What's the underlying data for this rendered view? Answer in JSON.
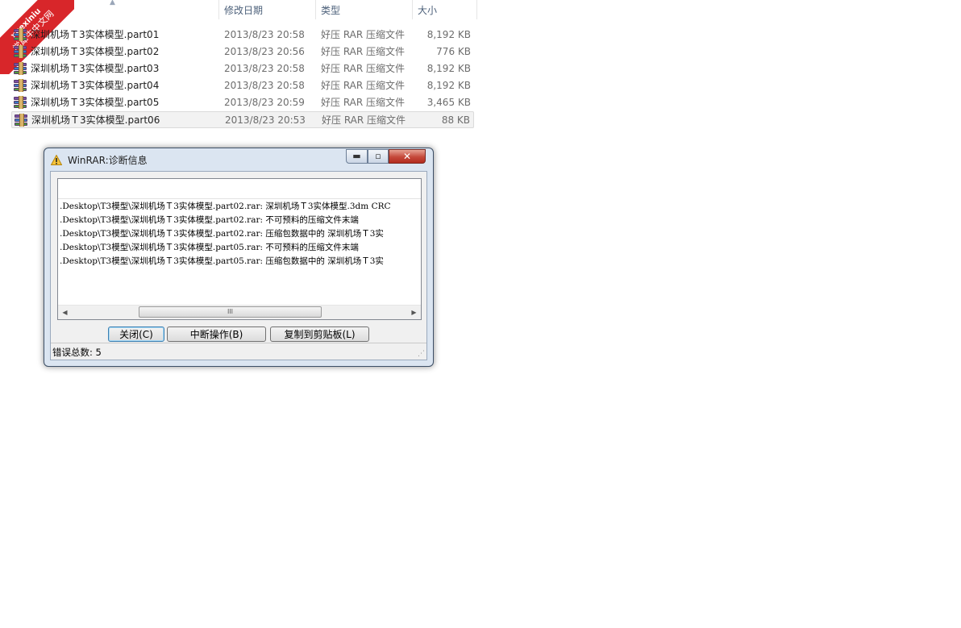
{
  "watermark": {
    "line1": "xuexiniu",
    "line2": "学犀牛中文网"
  },
  "columns": {
    "date": "修改日期",
    "type": "类型",
    "size": "大小"
  },
  "files": [
    {
      "name": "深圳机场Ｔ3实体模型.part01",
      "date": "2013/8/23 20:58",
      "type": "好压 RAR 压缩文件",
      "size": "8,192 KB"
    },
    {
      "name": "深圳机场Ｔ3实体模型.part02",
      "date": "2013/8/23 20:56",
      "type": "好压 RAR 压缩文件",
      "size": "776 KB"
    },
    {
      "name": "深圳机场Ｔ3实体模型.part03",
      "date": "2013/8/23 20:58",
      "type": "好压 RAR 压缩文件",
      "size": "8,192 KB"
    },
    {
      "name": "深圳机场Ｔ3实体模型.part04",
      "date": "2013/8/23 20:58",
      "type": "好压 RAR 压缩文件",
      "size": "8,192 KB"
    },
    {
      "name": "深圳机场Ｔ3实体模型.part05",
      "date": "2013/8/23 20:59",
      "type": "好压 RAR 压缩文件",
      "size": "3,465 KB"
    },
    {
      "name": "深圳机场Ｔ3实体模型.part06",
      "date": "2013/8/23 20:53",
      "type": "好压 RAR 压缩文件",
      "size": "88 KB"
    }
  ],
  "dialog": {
    "title": "WinRAR:诊断信息",
    "log": [
      ".Desktop\\T3模型\\深圳机场Ｔ3实体模型.part02.rar: 深圳机场Ｔ3实体模型.3dm CRC",
      ".Desktop\\T3模型\\深圳机场Ｔ3实体模型.part02.rar: 不可预料的压缩文件末端",
      ".Desktop\\T3模型\\深圳机场Ｔ3实体模型.part02.rar: 压缩包数据中的 深圳机场Ｔ3实",
      ".Desktop\\T3模型\\深圳机场Ｔ3实体模型.part05.rar: 不可预料的压缩文件末端",
      ".Desktop\\T3模型\\深圳机场Ｔ3实体模型.part05.rar: 压缩包数据中的 深圳机场Ｔ3实"
    ],
    "buttons": {
      "close": "关闭(C)",
      "abort": "中断操作(B)",
      "copy": "复制到剪贴板(L)"
    },
    "status": "错误总数: 5",
    "scroll_thumb": "III"
  }
}
